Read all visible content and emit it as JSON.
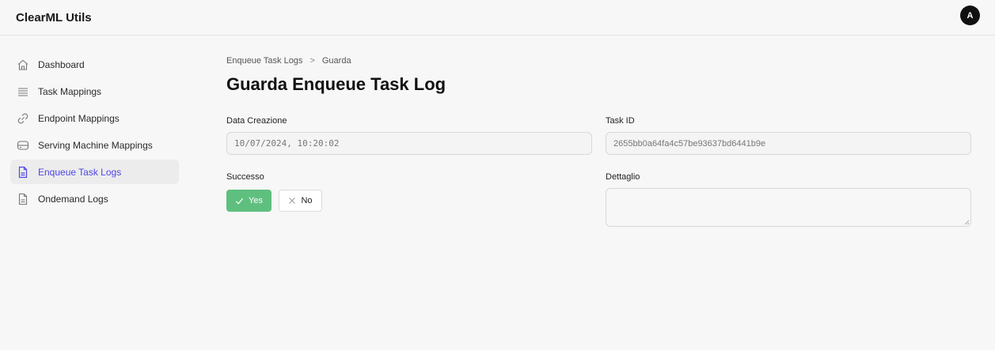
{
  "app": {
    "title": "ClearML Utils",
    "avatar_initial": "A"
  },
  "sidebar": {
    "items": [
      {
        "label": "Dashboard",
        "icon": "home-icon",
        "active": false
      },
      {
        "label": "Task Mappings",
        "icon": "list-icon",
        "active": false
      },
      {
        "label": "Endpoint Mappings",
        "icon": "link-icon",
        "active": false
      },
      {
        "label": "Serving Machine Mappings",
        "icon": "server-icon",
        "active": false
      },
      {
        "label": "Enqueue Task Logs",
        "icon": "document-icon",
        "active": true
      },
      {
        "label": "Ondemand Logs",
        "icon": "document-icon",
        "active": false
      }
    ]
  },
  "breadcrumb": {
    "parent": "Enqueue Task Logs",
    "separator": ">",
    "current": "Guarda"
  },
  "page": {
    "title": "Guarda Enqueue Task Log"
  },
  "form": {
    "data_creazione": {
      "label": "Data Creazione",
      "value": "10/07/2024, 10:20:02"
    },
    "task_id": {
      "label": "Task ID",
      "value": "2655bb0a64fa4c57be93637bd6441b9e"
    },
    "successo": {
      "label": "Successo",
      "yes_label": "Yes",
      "no_label": "No",
      "selected": "Yes"
    },
    "dettaglio": {
      "label": "Dettaglio",
      "value": ""
    }
  },
  "colors": {
    "accent": "#4f46e5",
    "success": "#5fbf7f"
  }
}
